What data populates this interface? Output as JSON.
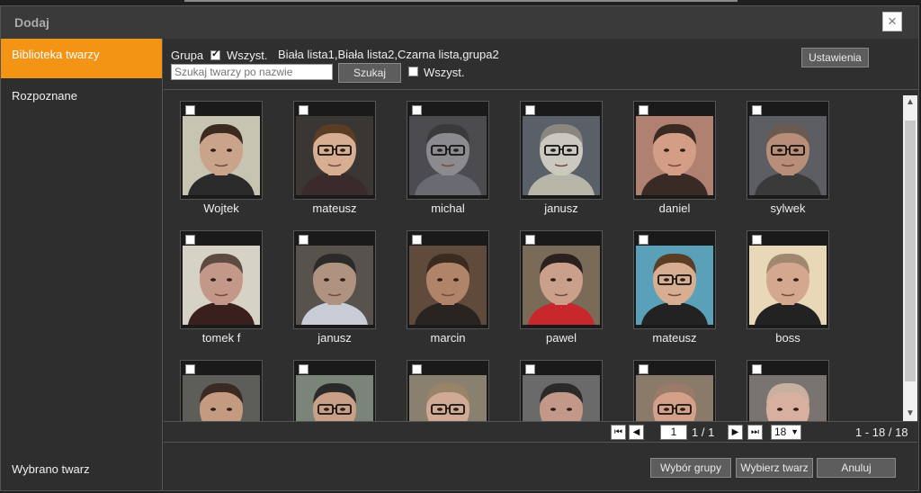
{
  "dialog": {
    "title": "Dodaj",
    "close_symbol": "×"
  },
  "sidebar": {
    "items": [
      {
        "label": "Biblioteka twarzy"
      },
      {
        "label": "Rozpoznane"
      }
    ],
    "footer": "Wybrano twarz"
  },
  "filter": {
    "group_label": "Grupa",
    "all_label": "Wszyst.",
    "groups_text": "Biała lista1,Biała lista2,Czarna lista,grupa2",
    "search_placeholder": "Szukaj twarzy po nazwie",
    "search_button": "Szukaj",
    "all_label2": "Wszyst.",
    "settings_button": "Ustawienia"
  },
  "faces": [
    {
      "name": "Wojtek",
      "skin": "#c9a38a",
      "hair": "#3a2a20",
      "bg": "#c7c4b2",
      "shirt": "#2a2a2a"
    },
    {
      "name": "mateusz",
      "skin": "#d7ae92",
      "hair": "#5a3d25",
      "bg": "#3a3633",
      "shirt": "#3a2a2a",
      "glasses": true
    },
    {
      "name": "michal",
      "skin": "#8a8a8f",
      "hair": "#3a3a3d",
      "bg": "#4c4c50",
      "shirt": "#6a6a72",
      "glasses": true
    },
    {
      "name": "janusz",
      "skin": "#cbc8c0",
      "hair": "#8a8680",
      "bg": "#5a6068",
      "shirt": "#b8b6a8",
      "glasses": true
    },
    {
      "name": "daniel",
      "skin": "#d49d86",
      "hair": "#3a2a22",
      "bg": "#b08070",
      "shirt": "#3a2a26"
    },
    {
      "name": "sylwek",
      "skin": "#b88e78",
      "hair": "#6a5a50",
      "bg": "#5d5e64",
      "shirt": "#3a3a3a",
      "glasses": true
    },
    {
      "name": "tomek f",
      "skin": "#c49888",
      "hair": "#5d4a40",
      "bg": "#d6d2c6",
      "shirt": "#3a1f1f"
    },
    {
      "name": "janusz",
      "skin": "#b09280",
      "hair": "#2d2a2a",
      "bg": "#58524c",
      "shirt": "#c8ccd6"
    },
    {
      "name": "marcin",
      "skin": "#b08468",
      "hair": "#3a2a20",
      "bg": "#604a3c",
      "shirt": "#2a2420"
    },
    {
      "name": "pawel",
      "skin": "#caa08a",
      "hair": "#2a2020",
      "bg": "#7a6a58",
      "shirt": "#c8282c"
    },
    {
      "name": "mateusz",
      "skin": "#d7ae92",
      "hair": "#5a3d25",
      "bg": "#5aa0b8",
      "shirt": "#222222",
      "glasses": true
    },
    {
      "name": "boss",
      "skin": "#d4a88e",
      "hair": "#a08870",
      "bg": "#e8d8b8",
      "shirt": "#222222"
    },
    {
      "name": "",
      "skin": "#c49a80",
      "hair": "#3a2a22",
      "bg": "#5d5d5a",
      "shirt": "#3a3a3a"
    },
    {
      "name": "",
      "skin": "#c8a088",
      "hair": "#2a2a2a",
      "bg": "#7a8478",
      "shirt": "#3a3a3a",
      "glasses": true
    },
    {
      "name": "",
      "skin": "#d0aa94",
      "hair": "#9a8468",
      "bg": "#8a8070",
      "shirt": "#3a3a3a",
      "glasses": true
    },
    {
      "name": "",
      "skin": "#c49888",
      "hair": "#2a2a2a",
      "bg": "#6a6a6a",
      "shirt": "#3a3a3a"
    },
    {
      "name": "",
      "skin": "#d4a08a",
      "hair": "#9a7a68",
      "bg": "#8a7a6a",
      "shirt": "#3a3a3a",
      "glasses": true
    },
    {
      "name": "",
      "skin": "#d8b0a0",
      "hair": "#c8b0a0",
      "bg": "#7a7470",
      "shirt": "#3a3a3a"
    }
  ],
  "pager": {
    "first": "⏮",
    "prev": "◀",
    "next": "▶",
    "last": "⏭",
    "page_value": "1",
    "page_total": "1 / 1",
    "per_page": "18",
    "range": "1 - 18 / 18"
  },
  "footer": {
    "group_select": "Wybór grupy",
    "select_face": "Wybierz twarz",
    "cancel": "Anuluj"
  }
}
